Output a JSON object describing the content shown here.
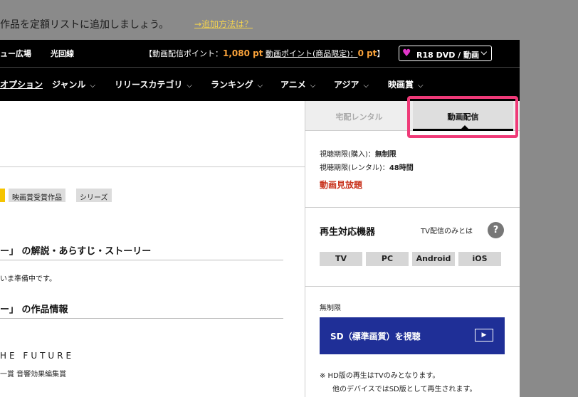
{
  "banner": {
    "text": "作品を定額リストに追加しましょう。",
    "link": "→追加方法は？"
  },
  "topbar": {
    "plaza": "ュー広場",
    "fiber": "光回線",
    "points_prefix": "【動画配信ポイント：",
    "points_value": "1,080 pt",
    "points_mid": "動画ポイント(商品限定)：",
    "points_value2": "0 pt",
    "points_suffix": "】",
    "select_label": "R18 DVD / 動画"
  },
  "nav": {
    "items": [
      {
        "label": "オプション"
      },
      {
        "label": "ジャンル"
      },
      {
        "label": "リリースカテゴリ"
      },
      {
        "label": "ランキング"
      },
      {
        "label": "アニメ"
      },
      {
        "label": "アジア"
      },
      {
        "label": "映画賞"
      }
    ]
  },
  "left": {
    "tags": [
      "映画賞受賞作品",
      "シリーズ"
    ],
    "story_heading": "ー」 の解説・あらすじ・ストーリー",
    "story_text": "いま準備中です。",
    "info_heading": "ー」 の作品情報",
    "future_text": "HE FUTURE",
    "award_text": "一賞 音響効果編集賞"
  },
  "right": {
    "tab_rental": "宅配レンタル",
    "tab_stream": "動画配信",
    "period_purchase_label": "視聴期限(購入)：",
    "period_purchase_value": "無制限",
    "period_rental_label": "視聴期限(レンタル)：",
    "period_rental_value": "48時間",
    "vod_label": "動画見放題",
    "devices_title": "再生対応機器",
    "tv_about": "TV配信のみとは",
    "devices": [
      "TV",
      "PC",
      "Android",
      "iOS"
    ],
    "unlimited": "無制限",
    "sd_button": "SD（標準画質）を視聴",
    "note_line1": "※  HD版の再生はTVのみとなります。",
    "note_line2": "他のデバイスではSD版として再生されます。"
  },
  "colors": {
    "accent_orange": "#f9a23a",
    "highlight_pink": "#ef3a78",
    "sd_button_blue": "#1f2f97",
    "vod_red": "#c9341e"
  }
}
